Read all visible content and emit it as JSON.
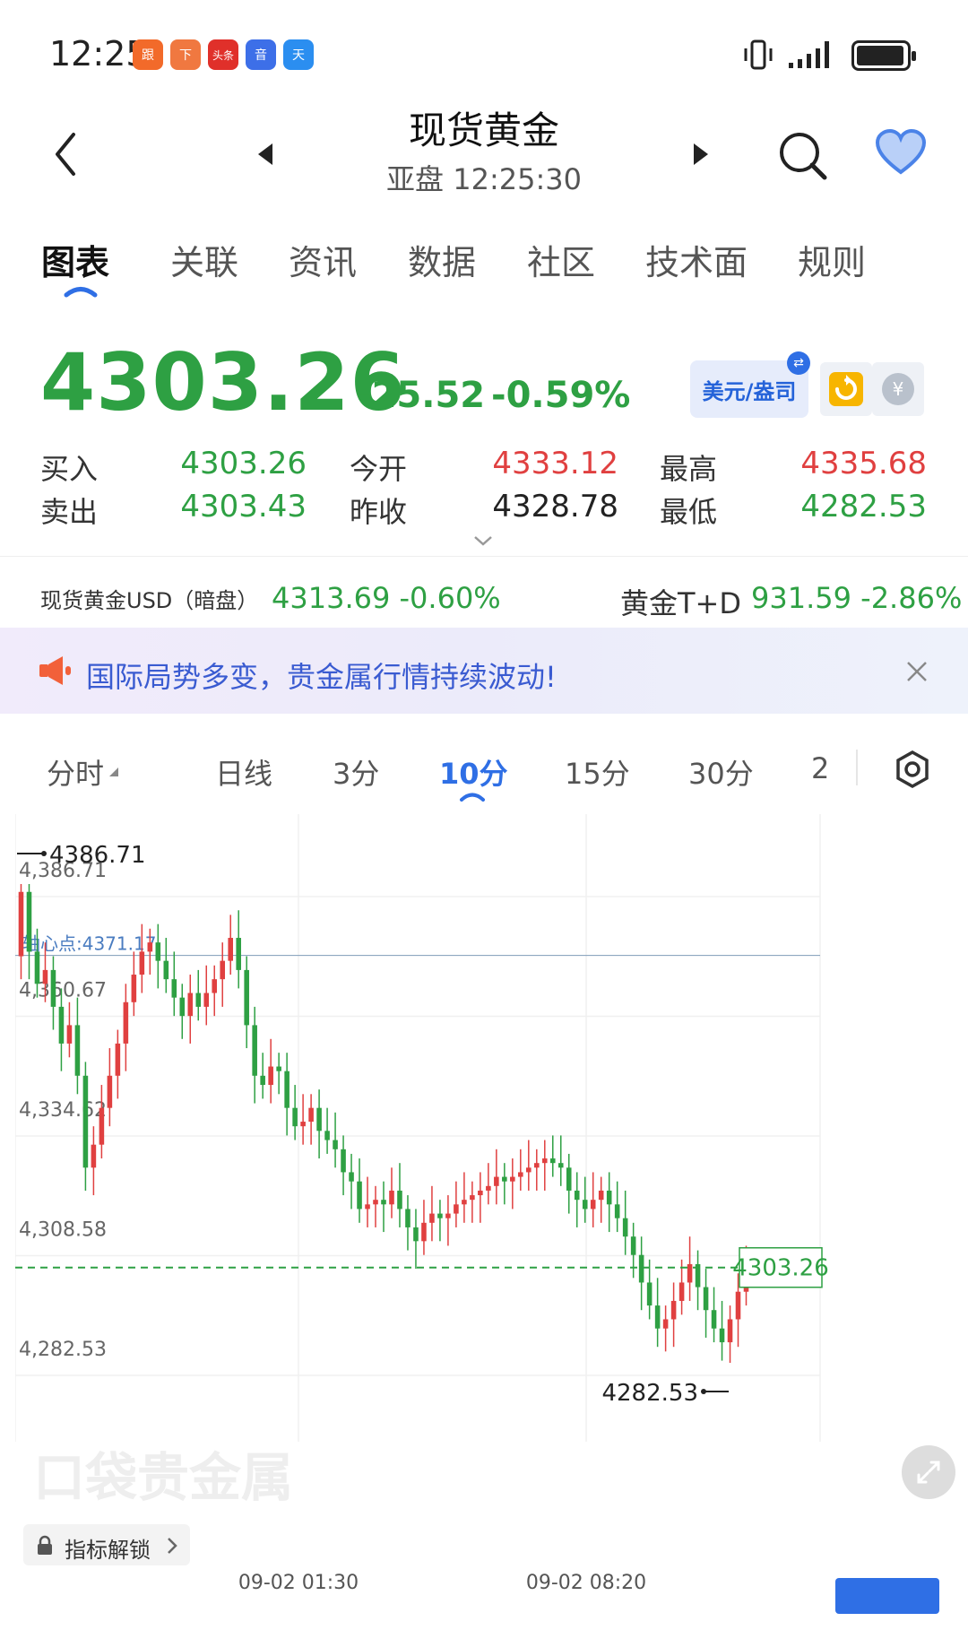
{
  "status_bar": {
    "time": "12:25",
    "app_icons": [
      "跟",
      "下",
      "头条",
      "音",
      "天"
    ]
  },
  "header": {
    "title": "现货黄金",
    "subtitle": "亚盘  12:25:30"
  },
  "tabs": [
    "图表",
    "关联",
    "资讯",
    "数据",
    "社区",
    "技术面",
    "规则"
  ],
  "quote": {
    "price": "4303.26",
    "change": "-25.52",
    "change_pct": "-0.59%",
    "unit_label": "美元/盎司",
    "stats": [
      {
        "label": "买入",
        "value": "4303.26"
      },
      {
        "label": "卖出",
        "value": "4303.43"
      },
      {
        "label": "今开",
        "value": "4333.12"
      },
      {
        "label": "昨收",
        "value": "4328.78"
      },
      {
        "label": "最高",
        "value": "4335.68"
      },
      {
        "label": "最低",
        "value": "4282.53"
      }
    ]
  },
  "tickers": [
    {
      "name": "现货黄金USD（暗盘）",
      "value": "4313.69 -0.60%"
    },
    {
      "name": "黄金T+D",
      "value": "931.59 -2.86%"
    }
  ],
  "notice": {
    "text": "国际局势多变，贵金属行情持续波动!"
  },
  "period_tabs": [
    "分时",
    "日线",
    "3分",
    "10分",
    "15分",
    "30分",
    "2"
  ],
  "chart": {
    "y_labels": [
      "4,386.71",
      "4,360.67",
      "4,334.62",
      "4,308.58",
      "4,282.53"
    ],
    "pivot_label": "轴心点:4371.17",
    "high_marker": "4386.71",
    "low_marker": "4282.53",
    "last_price_label": "4303.26",
    "x_labels": [
      "09-02 01:30",
      "09-02 08:20"
    ],
    "watermark": "口袋贵金属",
    "unlock_label": "指标解锁"
  },
  "chart_data": {
    "type": "candlestick",
    "x_labels": [
      "09-02 01:30",
      "09-02 08:20"
    ],
    "ylim": [
      4282.53,
      4386.71
    ],
    "pivot": 4371.17,
    "last": 4303.26,
    "close_series": [
      4385,
      4372,
      4365,
      4368,
      4360,
      4352,
      4356,
      4345,
      4325,
      4330,
      4338,
      4345,
      4352,
      4361,
      4367,
      4372,
      4374,
      4370,
      4366,
      4362,
      4358,
      4363,
      4360,
      4363,
      4366,
      4370,
      4375,
      4368,
      4356,
      4345,
      4343,
      4347,
      4346,
      4338,
      4334,
      4335,
      4338,
      4333,
      4331,
      4329,
      4324,
      4322,
      4316,
      4317,
      4318,
      4317,
      4320,
      4316,
      4312,
      4309,
      4313,
      4315,
      4314,
      4315,
      4317,
      4318,
      4319,
      4320,
      4321,
      4323,
      4322,
      4323,
      4324,
      4325,
      4326,
      4327,
      4326,
      4325,
      4320,
      4318,
      4316,
      4318,
      4320,
      4317,
      4314,
      4310,
      4306,
      4300,
      4295,
      4290,
      4292,
      4296,
      4300,
      4304,
      4299,
      4294,
      4290,
      4287,
      4292,
      4298,
      4303
    ]
  }
}
